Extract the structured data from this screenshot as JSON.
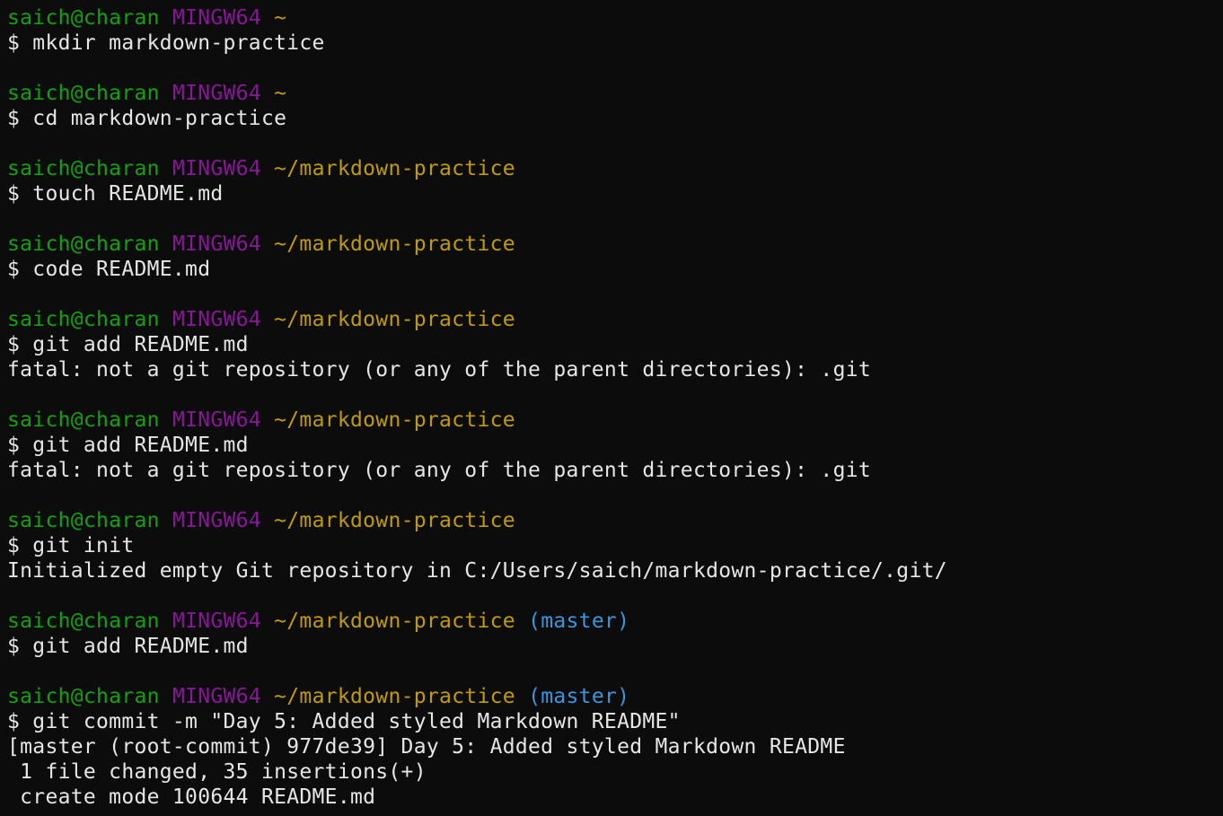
{
  "colors": {
    "background": "#0c0c0c",
    "text": "#e6e6e6",
    "user_host": "#13a10e",
    "system": "#881798",
    "path": "#c19c00",
    "branch": "#3a96dd"
  },
  "blocks": [
    {
      "prompt": {
        "user_host": "saich@charan",
        "system": "MINGW64",
        "path": "~",
        "branch": ""
      },
      "command": "$ mkdir markdown-practice",
      "output": []
    },
    {
      "prompt": {
        "user_host": "saich@charan",
        "system": "MINGW64",
        "path": "~",
        "branch": ""
      },
      "command": "$ cd markdown-practice",
      "output": []
    },
    {
      "prompt": {
        "user_host": "saich@charan",
        "system": "MINGW64",
        "path": "~/markdown-practice",
        "branch": ""
      },
      "command": "$ touch README.md",
      "output": []
    },
    {
      "prompt": {
        "user_host": "saich@charan",
        "system": "MINGW64",
        "path": "~/markdown-practice",
        "branch": ""
      },
      "command": "$ code README.md",
      "output": []
    },
    {
      "prompt": {
        "user_host": "saich@charan",
        "system": "MINGW64",
        "path": "~/markdown-practice",
        "branch": ""
      },
      "command": "$ git add README.md",
      "output": [
        "fatal: not a git repository (or any of the parent directories): .git"
      ]
    },
    {
      "prompt": {
        "user_host": "saich@charan",
        "system": "MINGW64",
        "path": "~/markdown-practice",
        "branch": ""
      },
      "command": "$ git add README.md",
      "output": [
        "fatal: not a git repository (or any of the parent directories): .git"
      ]
    },
    {
      "prompt": {
        "user_host": "saich@charan",
        "system": "MINGW64",
        "path": "~/markdown-practice",
        "branch": ""
      },
      "command": "$ git init",
      "output": [
        "Initialized empty Git repository in C:/Users/saich/markdown-practice/.git/"
      ]
    },
    {
      "prompt": {
        "user_host": "saich@charan",
        "system": "MINGW64",
        "path": "~/markdown-practice",
        "branch": "(master)"
      },
      "command": "$ git add README.md",
      "output": []
    },
    {
      "prompt": {
        "user_host": "saich@charan",
        "system": "MINGW64",
        "path": "~/markdown-practice",
        "branch": "(master)"
      },
      "command": "$ git commit -m \"Day 5: Added styled Markdown README\"",
      "output": [
        "[master (root-commit) 977de39] Day 5: Added styled Markdown README",
        " 1 file changed, 35 insertions(+)",
        " create mode 100644 README.md"
      ]
    }
  ]
}
